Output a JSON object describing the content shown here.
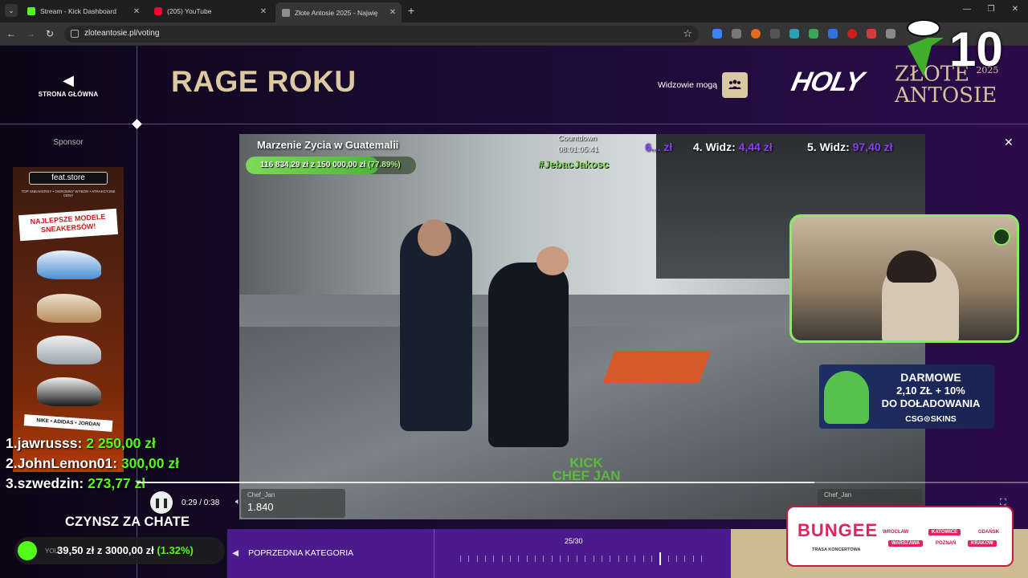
{
  "browser": {
    "tabs": [
      {
        "title": "Stream - Kick Dashboard",
        "active": false,
        "favicon_color": "#53fc18"
      },
      {
        "title": "(205) YouTube",
        "active": false,
        "favicon_color": "#ff0033"
      },
      {
        "title": "Złote Antosie 2025 - Najwię",
        "active": true,
        "favicon_color": "#8e8e8e"
      }
    ],
    "url": "zloteantosie.pl/voting"
  },
  "header": {
    "back_label": "STRONA GŁÓWNA",
    "title": "RAGE ROKU",
    "viewers_label": "Widzowie mogą",
    "logo_holy": "HOLY",
    "logo_zlote": "ZŁOTE",
    "logo_year": "2025",
    "logo_antosie": "ANTOSIE",
    "overlay_number": "10"
  },
  "sidebar": {
    "sponsor_label": "Sponsor",
    "ad_brand": "feat.store",
    "ad_subline": "TOP SNEAKERSY • OGROMNY WYBÓR • ATRAKCYJNE CENY",
    "ad_headline_1": "NAJLEPSZE MODELE",
    "ad_headline_2": "SNEAKERSÓW!",
    "ad_brands": "NIKE • ADIDAS • JORDAN"
  },
  "video": {
    "stream_title": "Marzenie Zycia w Guatemalii",
    "goal_raised": "116 834,29 zł",
    "goal_of": "z",
    "goal_target": "150 000,00 zł",
    "goal_percent": "(77.89%)",
    "goal_fraction": 0.7789,
    "countdown_label": "Countdown",
    "countdown_value": "08:01:05:41",
    "hashtag": "#JebacJakosc",
    "donations": [
      {
        "label": "",
        "amount": "6... zł"
      },
      {
        "label": "4. Widz:",
        "amount": "4,44 zł"
      },
      {
        "label": "5. Widz:",
        "amount": "97,40 zł"
      }
    ],
    "watermark_line1": "KICK",
    "watermark_line2": "CHEF JAN",
    "time": "0:29 / 0:38",
    "progress_fraction": 0.76,
    "chef_cards": [
      {
        "name": "Chef_Jan",
        "value": "1.840"
      },
      {
        "name": "Chef_Jan",
        "value": ""
      }
    ]
  },
  "csg_ad": {
    "line1": "DARMOWE",
    "line2": "2,10 ZŁ + 10%",
    "line3": "DO DOŁADOWANIA",
    "brand": "CSG⊙SKINS"
  },
  "leaderboard": [
    {
      "rank": "1.",
      "name": "jawrusss:",
      "amount": "2 250,00 zł"
    },
    {
      "rank": "2.",
      "name": "JohnLemon01:",
      "amount": "300,00 zł"
    },
    {
      "rank": "3.",
      "name": "szwedzin:",
      "amount": "273,77 zł"
    }
  ],
  "rent_goal": {
    "title": "CZYNSZ ZA CHATE",
    "under_text": "YOU",
    "raised": "39,50 zł",
    "of": "z",
    "target": "3000,00 zł",
    "percent": "(1.32%)"
  },
  "category_nav": {
    "prev_label": "POPRZEDNIA KATEGORIA",
    "count": "25/30",
    "current": 25,
    "total": 30
  },
  "bungee_ad": {
    "title": "BUNGEE",
    "subtitle": "TRASA KONCERTOWA",
    "cities": [
      "WROCŁAW",
      "KATOWICE",
      "GDAŃSK",
      "WARSZAWA",
      "POZNAŃ",
      "KRAKÓW"
    ]
  },
  "colors": {
    "kick_green": "#53fc18",
    "gold": "#dcc9a0",
    "purple": "#4b1a8c",
    "donation_purple": "#8a3ffc"
  }
}
